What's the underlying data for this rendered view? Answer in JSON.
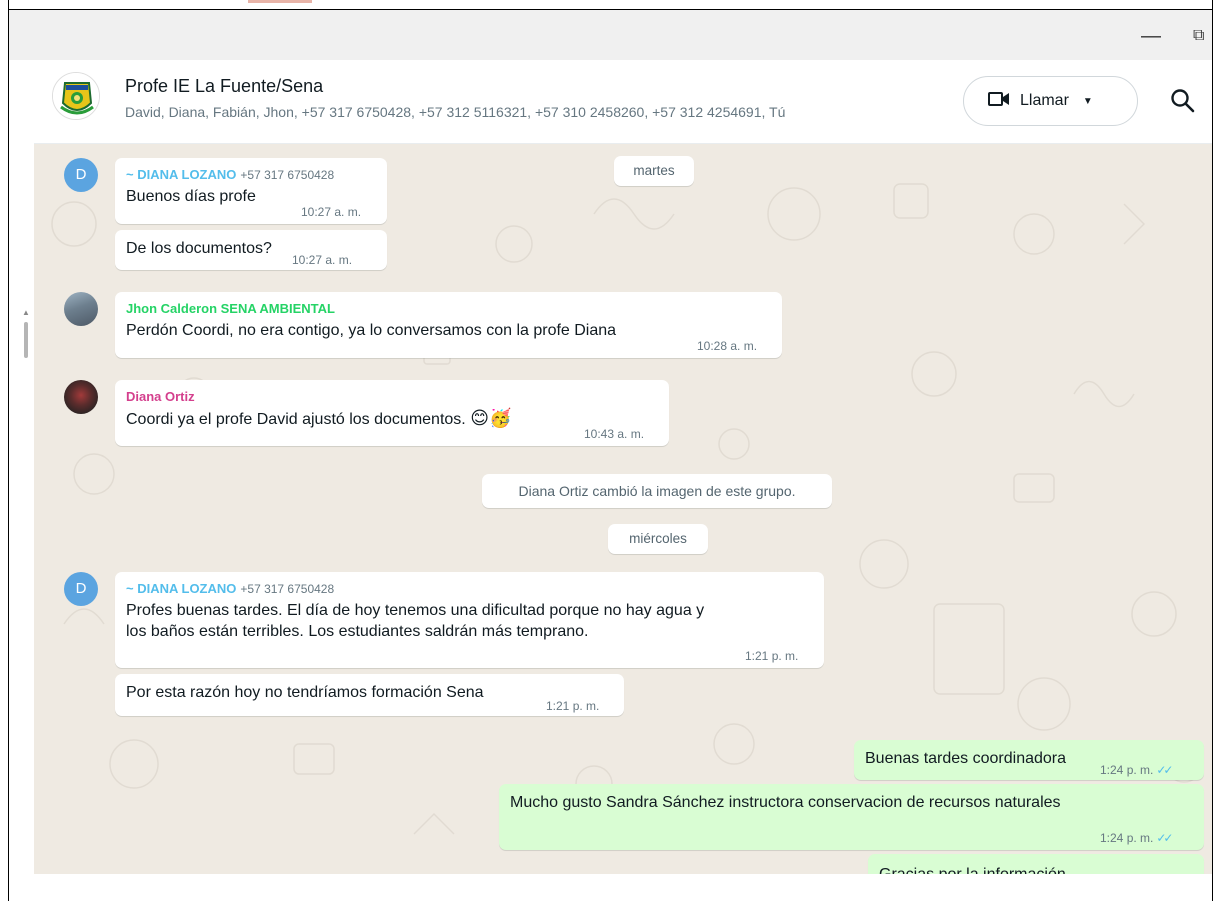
{
  "window": {
    "minimize_glyph": "—",
    "restore_glyph": "⧉"
  },
  "header": {
    "title": "Profe IE La Fuente/Sena",
    "members": "David, Diana, Fabián, Jhon, +57 317 6750428, +57 312 5116321, +57 310 2458260, +57 312 4254691, Tú",
    "call_label": "Llamar",
    "call_icon": "video-camera-icon",
    "search_icon": "search-icon"
  },
  "colors": {
    "chat_bg": "#efeae2",
    "outgoing_bubble": "#d9fdd3",
    "sender_diana_lozano": "#53bdeb",
    "sender_jhon": "#25d366",
    "sender_diana_ortiz": "#d43f8d",
    "read_ticks": "#53bdeb"
  },
  "messages": {
    "day_martes": "martes",
    "m1": {
      "sender": "~ DIANA LOZANO",
      "phone": "+57 317 6750428",
      "avatar_letter": "D",
      "text": "Buenos días profe",
      "time": "10:27 a. m."
    },
    "m2": {
      "text": "De los documentos?",
      "time": "10:27 a. m."
    },
    "m3": {
      "sender": "Jhon Calderon SENA AMBIENTAL",
      "text": "Perdón Coordi, no era contigo, ya lo conversamos con la profe Diana",
      "time": "10:28 a. m."
    },
    "m4": {
      "sender": "Diana Ortiz",
      "text": "Coordi ya el profe David ajustó los documentos.",
      "emoji": "😊🥳",
      "time": "10:43 a. m."
    },
    "system_1": "Diana Ortiz cambió la imagen de este grupo.",
    "day_miercoles": "miércoles",
    "m5": {
      "sender": "~ DIANA LOZANO",
      "phone": "+57 317 6750428",
      "avatar_letter": "D",
      "line1": "Profes buenas tardes. El día de hoy tenemos una dificultad porque no hay agua y",
      "line2": "los baños están terribles. Los estudiantes saldrán más temprano.",
      "time": "1:21 p. m."
    },
    "m6": {
      "text": "Por esta razón hoy no tendríamos formación Sena",
      "time": "1:21 p. m."
    },
    "m7": {
      "text": "Buenas tardes coordinadora",
      "time": "1:24 p. m.",
      "ticks": "✓✓"
    },
    "m8": {
      "text": "Mucho gusto Sandra Sánchez instructora conservacion de recursos naturales",
      "time": "1:24 p. m.",
      "ticks": "✓✓"
    },
    "m9": {
      "text": "Gracias por la información"
    }
  }
}
